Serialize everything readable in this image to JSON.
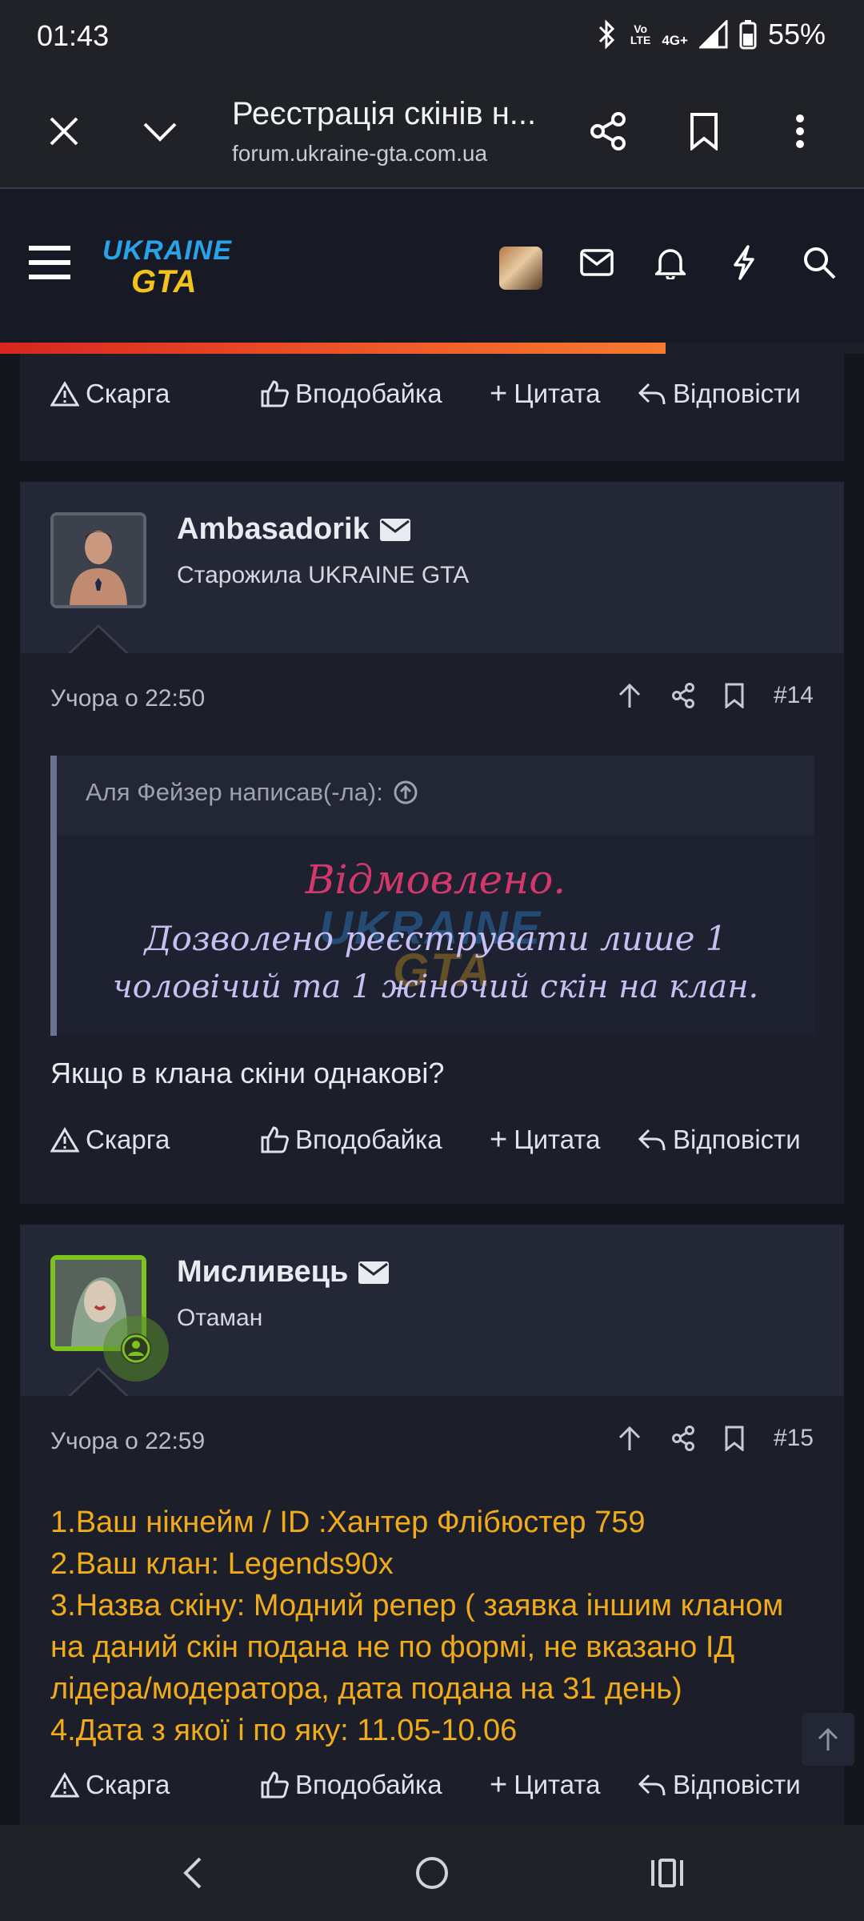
{
  "status": {
    "time": "01:43",
    "battery": "55%",
    "network": "4G+",
    "volte_top": "Vo",
    "volte_bottom": "LTE"
  },
  "browser": {
    "title": "Реєстрація скінів н...",
    "url": "forum.ukraine-gta.com.ua"
  },
  "site": {
    "logo_top": "UKRAINE",
    "logo_bottom": "GTA",
    "reading_progress_percent": 77
  },
  "top_actions": {
    "report": "Скарга",
    "like": "Вподобайка",
    "quote": "Цитата",
    "reply": "Відповісти"
  },
  "posts": [
    {
      "username": "Ambasadorik",
      "role": "Старожила UKRAINE GTA",
      "time": "Учора о 22:50",
      "number": "#14",
      "quote": {
        "author": "Аля Фейзер написав(-ла):",
        "line1": "Відмовлено.",
        "line2": "Дозволено реєструвати лише 1",
        "line3": "чоловічий та 1 жіночий скін на клан."
      },
      "body": "Якщо в клана скіни однакові?",
      "actions": {
        "report": "Скарга",
        "like": "Вподобайка",
        "quote": "Цитата",
        "reply": "Відповісти"
      }
    },
    {
      "username": "Мисливець",
      "role": "Отаман",
      "time": "Учора о 22:59",
      "number": "#15",
      "lines": [
        "1.Ваш нікнейм / ID :Хантер Флібюстер 759",
        "2.Ваш клан: Legends90x",
        "3.Назва скіну: Модний репер ( заявка іншим кланом",
        "на даний скін подана не по формі, не вказано ІД",
        "лідера/модератора, дата подана на 31 день)",
        "4.Дата з якої і по яку: 11.05-10.06"
      ],
      "actions": {
        "report": "Скарга",
        "like": "Вподобайка",
        "quote": "Цитата",
        "reply": "Відповісти"
      }
    }
  ],
  "colors": {
    "accent_gold": "#f0ab1a",
    "quote_red": "#d2386a",
    "quote_violet": "#c7bff2",
    "progress": "#ef5a2a"
  }
}
